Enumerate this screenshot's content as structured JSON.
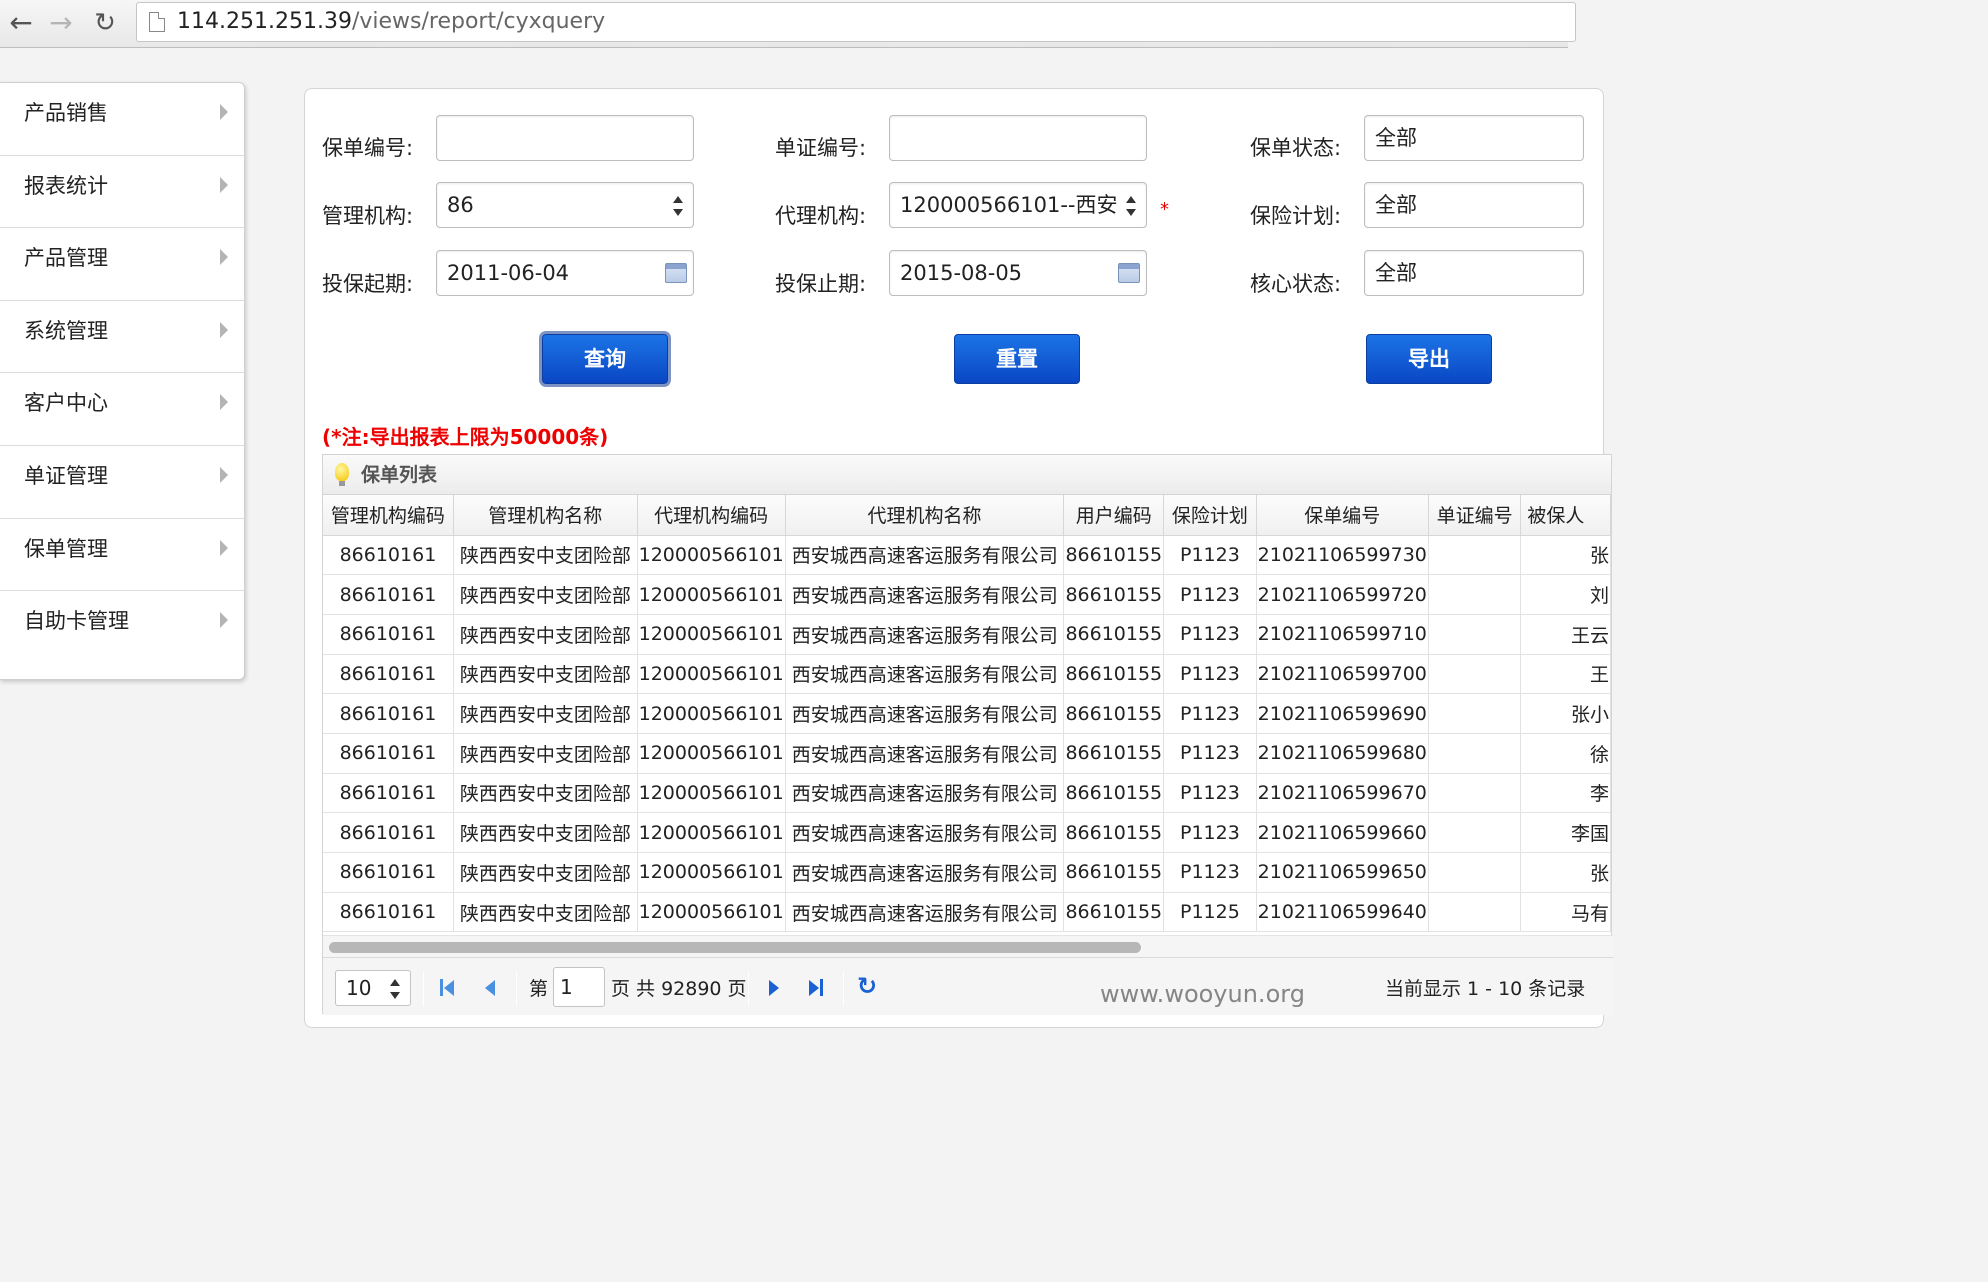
{
  "browser": {
    "back_icon": "back-arrow-icon",
    "forward_icon": "forward-arrow-icon",
    "reload_icon": "reload-icon",
    "url_host": "114.251.251.39",
    "url_path": "/views/report/cyxquery"
  },
  "sidebar": {
    "items": [
      {
        "label": "产品销售"
      },
      {
        "label": "报表统计"
      },
      {
        "label": "产品管理"
      },
      {
        "label": "系统管理"
      },
      {
        "label": "客户中心"
      },
      {
        "label": "单证管理"
      },
      {
        "label": "保单管理"
      },
      {
        "label": "自助卡管理"
      }
    ]
  },
  "form": {
    "policy_no_label": "保单编号:",
    "policy_no_value": "",
    "cert_no_label": "单证编号:",
    "cert_no_value": "",
    "policy_status_label": "保单状态:",
    "policy_status_value": "全部",
    "mgmt_org_label": "管理机构:",
    "mgmt_org_value": "86",
    "agent_org_label": "代理机构:",
    "agent_org_value": "120000566101--西安",
    "required_mark": "*",
    "plan_label": "保险计划:",
    "plan_value": "全部",
    "start_date_label": "投保起期:",
    "start_date_value": "2011-06-04",
    "end_date_label": "投保止期:",
    "end_date_value": "2015-08-05",
    "core_status_label": "核心状态:",
    "core_status_value": "全部"
  },
  "buttons": {
    "query": "查询",
    "reset": "重置",
    "export": "导出"
  },
  "note": "(*注:导出报表上限为50000条)",
  "grid": {
    "title": "保单列表",
    "columns": [
      "管理机构编码",
      "管理机构名称",
      "代理机构编码",
      "代理机构名称",
      "用户编码",
      "保险计划",
      "保单编号",
      "单证编号",
      "被保人"
    ],
    "rows": [
      [
        "86610161",
        "陕西西安中支团险部",
        "120000566101",
        "西安城西高速客运服务有限公司",
        "86610155",
        "P1123",
        "21021106599730",
        "",
        "张"
      ],
      [
        "86610161",
        "陕西西安中支团险部",
        "120000566101",
        "西安城西高速客运服务有限公司",
        "86610155",
        "P1123",
        "21021106599720",
        "",
        "刘"
      ],
      [
        "86610161",
        "陕西西安中支团险部",
        "120000566101",
        "西安城西高速客运服务有限公司",
        "86610155",
        "P1123",
        "21021106599710",
        "",
        "王云"
      ],
      [
        "86610161",
        "陕西西安中支团险部",
        "120000566101",
        "西安城西高速客运服务有限公司",
        "86610155",
        "P1123",
        "21021106599700",
        "",
        "王"
      ],
      [
        "86610161",
        "陕西西安中支团险部",
        "120000566101",
        "西安城西高速客运服务有限公司",
        "86610155",
        "P1123",
        "21021106599690",
        "",
        "张小"
      ],
      [
        "86610161",
        "陕西西安中支团险部",
        "120000566101",
        "西安城西高速客运服务有限公司",
        "86610155",
        "P1123",
        "21021106599680",
        "",
        "徐"
      ],
      [
        "86610161",
        "陕西西安中支团险部",
        "120000566101",
        "西安城西高速客运服务有限公司",
        "86610155",
        "P1123",
        "21021106599670",
        "",
        "李"
      ],
      [
        "86610161",
        "陕西西安中支团险部",
        "120000566101",
        "西安城西高速客运服务有限公司",
        "86610155",
        "P1123",
        "21021106599660",
        "",
        "李国"
      ],
      [
        "86610161",
        "陕西西安中支团险部",
        "120000566101",
        "西安城西高速客运服务有限公司",
        "86610155",
        "P1123",
        "21021106599650",
        "",
        "张"
      ],
      [
        "86610161",
        "陕西西安中支团险部",
        "120000566101",
        "西安城西高速客运服务有限公司",
        "86610155",
        "P1125",
        "21021106599640",
        "",
        "马有"
      ]
    ]
  },
  "pager": {
    "page_size": "10",
    "page_prefix": "第",
    "page_value": "1",
    "page_suffix": "页 共 92890 页",
    "summary": "当前显示 1 - 10 条记录"
  },
  "watermark": "www.wooyun.org"
}
